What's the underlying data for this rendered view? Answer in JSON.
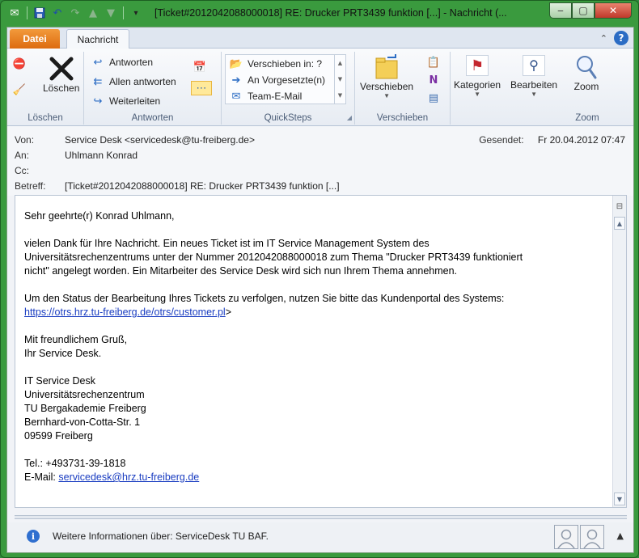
{
  "window": {
    "title": "[Ticket#2012042088000018] RE: Drucker PRT3439 funktion [...]  -  Nachricht (...",
    "minimize": "‒",
    "maximize": "▢",
    "close": "✕"
  },
  "tabs": {
    "file": "Datei",
    "message": "Nachricht"
  },
  "ribbon": {
    "groups": {
      "loeschen": {
        "label": "Löschen",
        "delete": "Löschen"
      },
      "antworten": {
        "label": "Antworten",
        "reply": "Antworten",
        "reply_all": "Allen antworten",
        "forward": "Weiterleiten"
      },
      "quicksteps": {
        "label": "QuickSteps",
        "items": [
          "Verschieben in: ?",
          "An Vorgesetzte(n)",
          "Team-E-Mail"
        ]
      },
      "verschieben": {
        "label": "Verschieben",
        "move": "Verschieben"
      },
      "kategorien": {
        "label": "Kategorien"
      },
      "bearbeiten": {
        "label": "Bearbeiten"
      },
      "zoom": {
        "label": "Zoom",
        "zoom": "Zoom"
      }
    }
  },
  "header": {
    "from_label": "Von:",
    "from": "Service Desk <servicedesk@tu-freiberg.de>",
    "to_label": "An:",
    "to": "Uhlmann Konrad",
    "cc_label": "Cc:",
    "cc": "",
    "subject_label": "Betreff:",
    "subject": "[Ticket#2012042088000018] RE: Drucker PRT3439 funktion [...]",
    "sent_label": "Gesendet:",
    "sent": "Fr 20.04.2012 07:47"
  },
  "body": {
    "greeting": "Sehr geehrte(r) Konrad Uhlmann,",
    "para1_line1": "vielen Dank für Ihre Nachricht. Ein neues Ticket ist im IT Service Management System des",
    "para1_line2": "Universitätsrechenzentrums unter der Nummer 2012042088000018 zum Thema \"Drucker PRT3439 funktioniert",
    "para1_line3": "nicht\" angelegt worden. Ein Mitarbeiter des Service Desk wird sich nun Ihrem Thema annehmen.",
    "para2_line1": "Um den Status der Bearbeitung Ihres Tickets zu verfolgen, nutzen Sie bitte das Kundenportal des Systems:",
    "portal_link": "https://otrs.hrz.tu-freiberg.de/otrs/customer.pl",
    "portal_suffix": ">",
    "closing1": "Mit freundlichem Gruß,",
    "closing2": "Ihr Service Desk.",
    "sig1": "IT Service Desk",
    "sig2": "Universitätsrechenzentrum",
    "sig3": "TU Bergakademie Freiberg",
    "sig4": "Bernhard-von-Cotta-Str. 1",
    "sig5": "09599 Freiberg",
    "tel": "Tel.: +493731-39-1818",
    "email_prefix": "E-Mail: ",
    "email_link": "servicedesk@hrz.tu-freiberg.de"
  },
  "people_pane": {
    "info": "Weitere Informationen über: ServiceDesk TU BAF."
  },
  "colors": {
    "file_tab": "#dd6b10",
    "link": "#1a3dc1",
    "window_frame": "#3a9a3e"
  }
}
